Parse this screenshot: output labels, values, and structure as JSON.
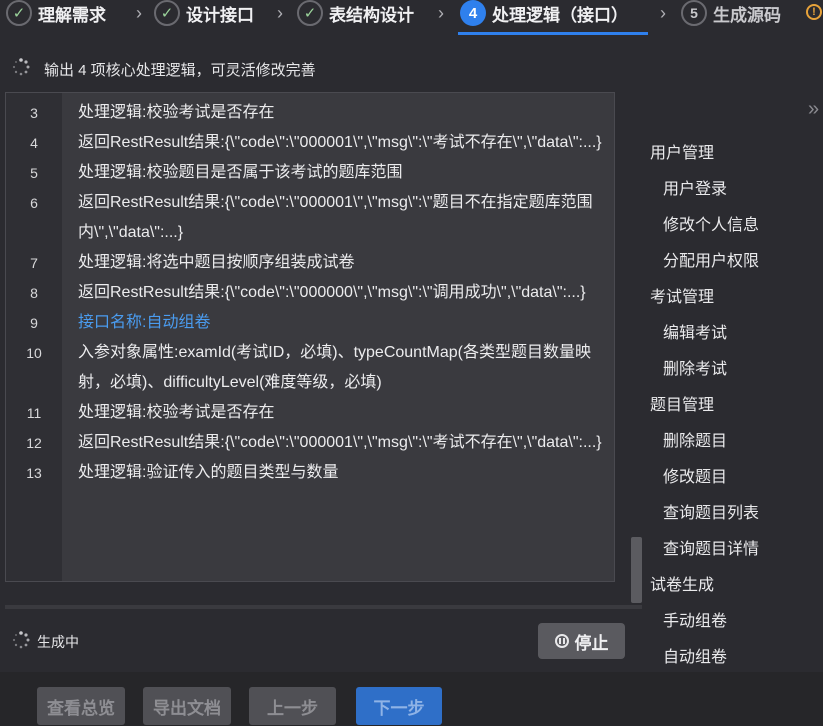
{
  "stepper": {
    "steps": [
      {
        "label": "理解需求",
        "status": "done"
      },
      {
        "label": "设计接口",
        "status": "done"
      },
      {
        "label": "表结构设计",
        "status": "done"
      },
      {
        "label": "处理逻辑（接口）",
        "number": "4",
        "status": "active"
      },
      {
        "label": "生成源码",
        "number": "5",
        "status": "todo"
      }
    ],
    "check_glyph": "✓",
    "separator": "›",
    "warning_glyph": "!"
  },
  "subtitle": "输出 4 项核心处理逻辑，可灵活修改完善",
  "code_lines": [
    {
      "num": "3",
      "text": "处理逻辑:校验考试是否存在",
      "highlight": false
    },
    {
      "num": "4",
      "text": "返回RestResult结果:{\\\"code\\\":\\\"000001\\\",\\\"msg\\\":\\\"考试不存在\\\",\\\"data\\\":...}",
      "highlight": false
    },
    {
      "num": "5",
      "text": "处理逻辑:校验题目是否属于该考试的题库范围",
      "highlight": false
    },
    {
      "num": "6",
      "text": "返回RestResult结果:{\\\"code\\\":\\\"000001\\\",\\\"msg\\\":\\\"题目不在指定题库范围内\\\",\\\"data\\\":...}",
      "highlight": false
    },
    {
      "num": "7",
      "text": "处理逻辑:将选中题目按顺序组装成试卷",
      "highlight": false
    },
    {
      "num": "8",
      "text": "返回RestResult结果:{\\\"code\\\":\\\"000000\\\",\\\"msg\\\":\\\"调用成功\\\",\\\"data\\\":...}",
      "highlight": false
    },
    {
      "num": "9",
      "text": "接口名称:自动组卷",
      "highlight": true
    },
    {
      "num": "10",
      "text": "入参对象属性:examId(考试ID，必填)、typeCountMap(各类型题目数量映射，必填)、difficultyLevel(难度等级，必填)",
      "highlight": false
    },
    {
      "num": "11",
      "text": "处理逻辑:校验考试是否存在",
      "highlight": false
    },
    {
      "num": "12",
      "text": "返回RestResult结果:{\\\"code\\\":\\\"000001\\\",\\\"msg\\\":\\\"考试不存在\\\",\\\"data\\\":...}",
      "highlight": false
    },
    {
      "num": "13",
      "text": "处理逻辑:验证传入的题目类型与数量",
      "highlight": false
    }
  ],
  "nav": [
    {
      "group": "用户管理",
      "items": [
        "用户登录",
        "修改个人信息",
        "分配用户权限"
      ]
    },
    {
      "group": "考试管理",
      "items": [
        "编辑考试",
        "删除考试"
      ]
    },
    {
      "group": "题目管理",
      "items": [
        "删除题目",
        "修改题目",
        "查询题目列表",
        "查询题目详情"
      ]
    },
    {
      "group": "试卷生成",
      "items": [
        "手动组卷",
        "自动组卷"
      ]
    }
  ],
  "collapse_glyph": "»",
  "status": {
    "generating_label": "生成中",
    "stop_label": "停止"
  },
  "footer": {
    "buttons": [
      {
        "label": "查看总览",
        "style": "grey"
      },
      {
        "label": "导出文档",
        "style": "grey"
      },
      {
        "label": "上一步",
        "style": "grey"
      },
      {
        "label": "下一步",
        "style": "blue"
      }
    ]
  },
  "colors": {
    "accent": "#2f80ed",
    "highlight_text": "#4a9cf0",
    "warning": "#e8a33a"
  }
}
